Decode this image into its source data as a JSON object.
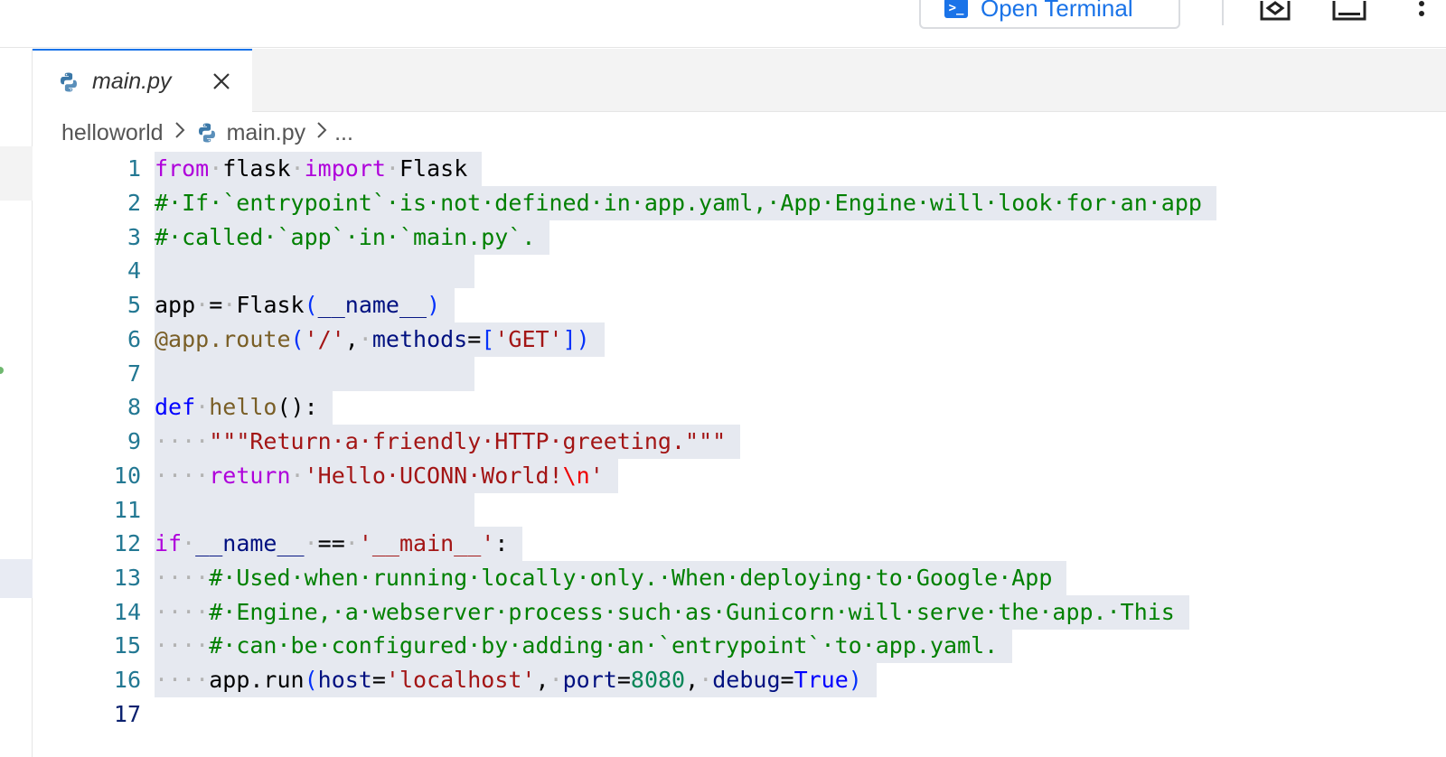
{
  "toolbar": {
    "open_terminal_label": "Open Terminal"
  },
  "tab": {
    "label": "main.py"
  },
  "breadcrumb": {
    "folder": "helloworld",
    "file": "main.py",
    "more": "..."
  },
  "editor": {
    "active_line": 17,
    "line_numbers": [
      "1",
      "2",
      "3",
      "4",
      "5",
      "6",
      "7",
      "8",
      "9",
      "10",
      "11",
      "12",
      "13",
      "14",
      "15",
      "16",
      "17"
    ]
  },
  "code": {
    "l1": {
      "a": "from",
      "b": "·",
      "c": "flask",
      "d": "·",
      "e": "import",
      "f": "·",
      "g": "Flask"
    },
    "l2": "#·If·`entrypoint`·is·not·defined·in·app.yaml,·App·Engine·will·look·for·an·app",
    "l3": "#·called·`app`·in·`main.py`.",
    "l5": {
      "a": "app",
      "b": "·",
      "c": "=",
      "d": "·",
      "e": "Flask",
      "f": "(",
      "g": "__name__",
      "h": ")"
    },
    "l6": {
      "a": "@app.route",
      "b": "(",
      "c": "'/'",
      "d": ",",
      "e": "·",
      "f": "methods",
      "g": "=",
      "h": "[",
      "i": "'GET'",
      "j": "])"
    },
    "l8": {
      "a": "def",
      "b": "·",
      "c": "hello",
      "d": "():"
    },
    "l9": {
      "ws": "····",
      "s": "\"\"\"Return·a·friendly·HTTP·greeting.\"\"\""
    },
    "l10": {
      "ws": "····",
      "k": "return",
      "sp": "·",
      "s": "'Hello·UCONN·World!",
      "e": "\\n",
      "q": "'"
    },
    "l12": {
      "a": "if",
      "b": "·",
      "c": "__name__",
      "d": "·",
      "e": "==",
      "f": "·",
      "g": "'__main__'",
      "h": ":"
    },
    "l13": {
      "ws": "····",
      "c": "#·Used·when·running·locally·only.·When·deploying·to·Google·App"
    },
    "l14": {
      "ws": "····",
      "c": "#·Engine,·a·webserver·process·such·as·Gunicorn·will·serve·the·app.·This"
    },
    "l15": {
      "ws": "····",
      "c": "#·can·be·configured·by·adding·an·`entrypoint`·to·app.yaml."
    },
    "l16": {
      "ws": "····",
      "a": "app.run",
      "b": "(",
      "c": "host",
      "d": "=",
      "e": "'localhost'",
      "f": ",",
      "g": "·",
      "h": "port",
      "i": "=",
      "j": "8080",
      "k": ",",
      "l": "·",
      "m": "debug",
      "n": "=",
      "o": "True",
      "p": ")"
    }
  }
}
